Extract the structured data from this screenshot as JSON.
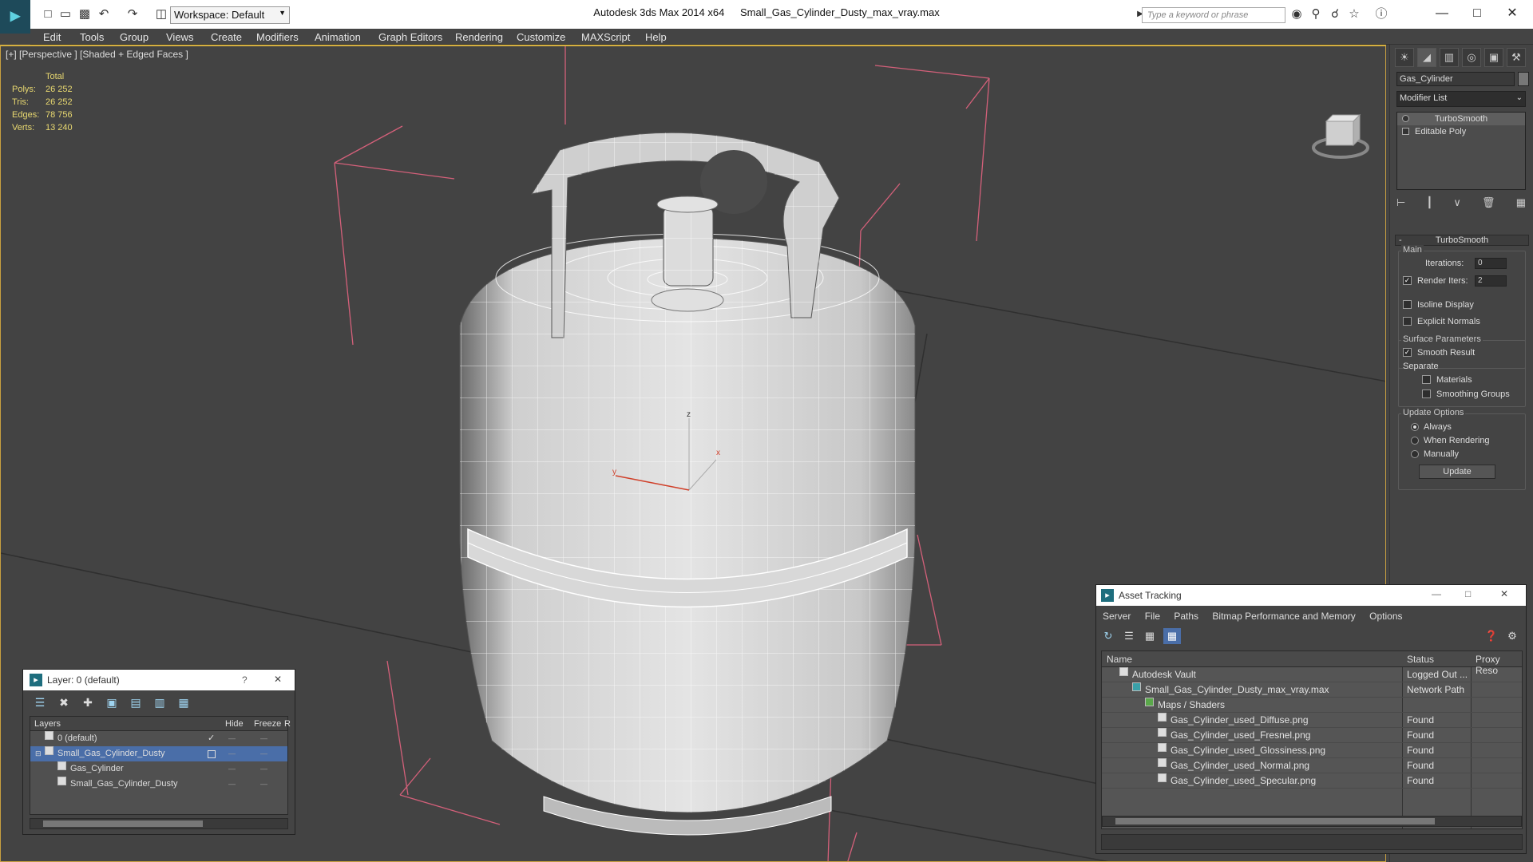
{
  "app": {
    "title_app": "Autodesk 3ds Max  2014 x64",
    "title_file": "Small_Gas_Cylinder_Dusty_max_vray.max",
    "workspace": "Workspace: Default",
    "search_placeholder": "Type a keyword or phrase"
  },
  "menu": [
    "Edit",
    "Tools",
    "Group",
    "Views",
    "Create",
    "Modifiers",
    "Animation",
    "Graph Editors",
    "Rendering",
    "Customize",
    "MAXScript",
    "Help"
  ],
  "viewport": {
    "label": "[+] [Perspective ] [Shaded + Edged Faces ]",
    "stats": {
      "header": "Total",
      "rows": [
        {
          "k": "Polys:",
          "v": "26 252"
        },
        {
          "k": "Tris:",
          "v": "26 252"
        },
        {
          "k": "Edges:",
          "v": "78 756"
        },
        {
          "k": "Verts:",
          "v": "13 240"
        }
      ]
    },
    "axis": {
      "z": "z",
      "x": "x",
      "y": "y"
    }
  },
  "command_panel": {
    "object_name": "Gas_Cylinder",
    "modifier_list": "Modifier List",
    "stack": [
      "TurboSmooth",
      "Editable Poly"
    ],
    "rollout_title": "TurboSmooth",
    "main_group": "Main",
    "iterations_label": "Iterations:",
    "iterations_value": "0",
    "render_iters_label": "Render Iters:",
    "render_iters_value": "2",
    "render_iters_checked": true,
    "isoline_label": "Isoline Display",
    "explicit_normals_label": "Explicit Normals",
    "surface_group": "Surface Parameters",
    "smooth_result_label": "Smooth Result",
    "separate_label": "Separate",
    "materials_label": "Materials",
    "smoothing_groups_label": "Smoothing Groups",
    "update_group": "Update Options",
    "always_label": "Always",
    "when_rendering_label": "When Rendering",
    "manually_label": "Manually",
    "update_button": "Update"
  },
  "layer_dialog": {
    "title": "Layer: 0 (default)",
    "help": "?",
    "columns": {
      "layers": "Layers",
      "hide": "Hide",
      "freeze": "Freeze",
      "r": "R"
    },
    "rows": [
      {
        "name": "0 (default)",
        "indent": 0
      },
      {
        "name": "Small_Gas_Cylinder_Dusty",
        "indent": 0
      },
      {
        "name": "Gas_Cylinder",
        "indent": 1
      },
      {
        "name": "Small_Gas_Cylinder_Dusty",
        "indent": 1
      }
    ]
  },
  "asset_tracking": {
    "title": "Asset Tracking",
    "menu": [
      "Server",
      "File",
      "Paths",
      "Bitmap Performance and Memory",
      "Options"
    ],
    "columns": {
      "name": "Name",
      "status": "Status",
      "proxy": "Proxy Reso"
    },
    "rows": [
      {
        "name": "Autodesk Vault",
        "status": "Logged Out ...",
        "indent": 1
      },
      {
        "name": "Small_Gas_Cylinder_Dusty_max_vray.max",
        "status": "Network Path",
        "indent": 2
      },
      {
        "name": "Maps / Shaders",
        "status": "",
        "indent": 3
      },
      {
        "name": "Gas_Cylinder_used_Diffuse.png",
        "status": "Found",
        "indent": 4
      },
      {
        "name": "Gas_Cylinder_used_Fresnel.png",
        "status": "Found",
        "indent": 4
      },
      {
        "name": "Gas_Cylinder_used_Glossiness.png",
        "status": "Found",
        "indent": 4
      },
      {
        "name": "Gas_Cylinder_used_Normal.png",
        "status": "Found",
        "indent": 4
      },
      {
        "name": "Gas_Cylinder_used_Specular.png",
        "status": "Found",
        "indent": 4
      }
    ]
  },
  "icons": {
    "minimize": "minimize-icon",
    "maximize": "maximize-icon",
    "close": "close-icon"
  }
}
